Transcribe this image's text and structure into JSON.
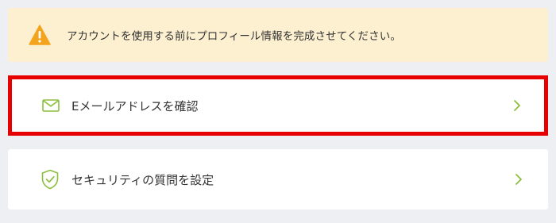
{
  "banner": {
    "icon": "warning-triangle-icon",
    "text": "アカウントを使用する前にプロフィール情報を完成させてください。",
    "icon_color": "#f4a31c",
    "background": "#fdf0d0"
  },
  "items": [
    {
      "icon": "envelope-icon",
      "label": "Eメールアドレスを確認",
      "highlighted": true
    },
    {
      "icon": "shield-check-icon",
      "label": "セキュリティの質問を設定",
      "highlighted": false
    }
  ],
  "colors": {
    "accent": "#8cbf3f",
    "highlight_border": "#e60000",
    "page_background": "#eeeff3"
  }
}
